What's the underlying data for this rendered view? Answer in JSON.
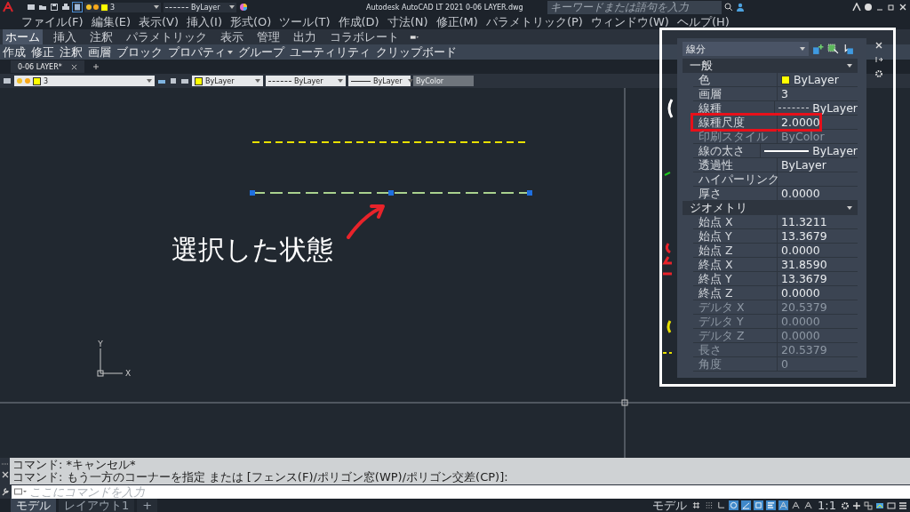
{
  "title_bar": {
    "quick_layer": "3",
    "quick_linetype": "ByLayer",
    "title": "Autodesk AutoCAD LT 2021  0-06 LAYER.dwg",
    "search": {
      "placeholder": "キーワードまたは語句を入力"
    }
  },
  "menu": [
    "ファイル(F)",
    "編集(E)",
    "表示(V)",
    "挿入(I)",
    "形式(O)",
    "ツール(T)",
    "作成(D)",
    "寸法(N)",
    "修正(M)",
    "パラメトリック(P)",
    "ウィンドウ(W)",
    "ヘルプ(H)"
  ],
  "ribbon_tabs": [
    {
      "label": "ホーム",
      "selected": true
    },
    {
      "label": "挿入",
      "selected": false
    },
    {
      "label": "注釈",
      "selected": false
    },
    {
      "label": "パラメトリック",
      "selected": false
    },
    {
      "label": "表示",
      "selected": false
    },
    {
      "label": "管理",
      "selected": false
    },
    {
      "label": "出力",
      "selected": false
    },
    {
      "label": "コラボレート",
      "selected": false
    }
  ],
  "ribbon_panels": [
    {
      "label": "作成",
      "dropdown": false
    },
    {
      "label": "修正",
      "dropdown": false
    },
    {
      "label": "注釈",
      "dropdown": false
    },
    {
      "label": "画層",
      "dropdown": false
    },
    {
      "label": "ブロック",
      "dropdown": false
    },
    {
      "label": "プロパティ",
      "dropdown": true
    },
    {
      "label": "グループ",
      "dropdown": false
    },
    {
      "label": "ユーティリティ",
      "dropdown": false
    },
    {
      "label": "クリップボード",
      "dropdown": false
    }
  ],
  "document_tabs": [
    {
      "label": "0-06 LAYER*",
      "selected": true
    }
  ],
  "properties_toolbar": {
    "layer": "3",
    "color_setting": "ByLayer",
    "linetype": "ByLayer",
    "lineweight": "ByLayer",
    "plot_style": {
      "value": "ByColor",
      "disabled": true
    }
  },
  "canvas": {
    "annotation": "選択した状態",
    "ucs_x": "X",
    "ucs_y": "Y"
  },
  "properties_palette": {
    "object_type": "線分",
    "sections": [
      {
        "title": "一般",
        "expanded": true,
        "rows": [
          {
            "label": "色",
            "value": "ByLayer",
            "kind": "color",
            "disabled": false,
            "highlighted": false
          },
          {
            "label": "画層",
            "value": "3",
            "kind": "text",
            "disabled": false,
            "highlighted": false
          },
          {
            "label": "線種",
            "value": "ByLayer",
            "kind": "linetype",
            "disabled": false,
            "highlighted": false
          },
          {
            "label": "線種尺度",
            "value": "2.0000",
            "kind": "text",
            "disabled": false,
            "highlighted": true
          },
          {
            "label": "印刷スタイル",
            "value": "ByColor",
            "kind": "text",
            "disabled": true,
            "highlighted": false
          },
          {
            "label": "線の太さ",
            "value": "ByLayer",
            "kind": "lineweight",
            "disabled": false,
            "highlighted": false
          },
          {
            "label": "透過性",
            "value": "ByLayer",
            "kind": "text",
            "disabled": false,
            "highlighted": false
          },
          {
            "label": "ハイパーリンク",
            "disabled": false,
            "highlighted": false
          },
          {
            "label": "厚さ",
            "value": "0.0000",
            "kind": "text",
            "disabled": false,
            "highlighted": false
          }
        ]
      },
      {
        "title": "ジオメトリ",
        "expanded": true,
        "rows": [
          {
            "label": "始点 X",
            "value": "11.3211",
            "kind": "text",
            "disabled": false,
            "highlighted": false
          },
          {
            "label": "始点 Y",
            "value": "13.3679",
            "kind": "text",
            "disabled": false,
            "highlighted": false
          },
          {
            "label": "始点 Z",
            "value": "0.0000",
            "kind": "text",
            "disabled": false,
            "highlighted": false
          },
          {
            "label": "終点 X",
            "value": "31.8590",
            "kind": "text",
            "disabled": false,
            "highlighted": false
          },
          {
            "label": "終点 Y",
            "value": "13.3679",
            "kind": "text",
            "disabled": false,
            "highlighted": false
          },
          {
            "label": "終点 Z",
            "value": "0.0000",
            "kind": "text",
            "disabled": false,
            "highlighted": false
          },
          {
            "label": "デルタ X",
            "value": "20.5379",
            "kind": "text",
            "disabled": true,
            "highlighted": false
          },
          {
            "label": "デルタ Y",
            "value": "0.0000",
            "kind": "text",
            "disabled": true,
            "highlighted": false
          },
          {
            "label": "デルタ Z",
            "value": "0.0000",
            "kind": "text",
            "disabled": true,
            "highlighted": false
          },
          {
            "label": "長さ",
            "value": "20.5379",
            "kind": "text",
            "disabled": true,
            "highlighted": false
          },
          {
            "label": "角度",
            "value": "0",
            "kind": "text",
            "disabled": true,
            "highlighted": false
          }
        ]
      }
    ]
  },
  "command_line": {
    "history": [
      "コマンド: *キャンセル*",
      "コマンド: もう一方のコーナーを指定 または [フェンス(F)/ポリゴン窓(WP)/ポリゴン交差(CP)]:"
    ],
    "placeholder": "ここにコマンドを入力"
  },
  "layout_tabs": [
    {
      "label": "モデル",
      "selected": true
    },
    {
      "label": "レイアウト1",
      "selected": false
    },
    {
      "label": "+",
      "selected": false
    }
  ],
  "status_bar": {
    "space": "モデル",
    "scale": "1:1",
    "toggles": [
      {
        "kind": "grid",
        "on": false
      },
      {
        "kind": "snap",
        "on": false
      },
      {
        "kind": "ortho",
        "on": false
      },
      {
        "kind": "polar",
        "on": true
      },
      {
        "kind": "isodraft",
        "on": true
      },
      {
        "kind": "osnap",
        "on": true
      },
      {
        "kind": "lineweight",
        "on": true
      },
      {
        "kind": "annovis",
        "on": true
      },
      {
        "kind": "autoscale",
        "on": false
      },
      {
        "kind": "annoscale",
        "on": false
      }
    ]
  }
}
